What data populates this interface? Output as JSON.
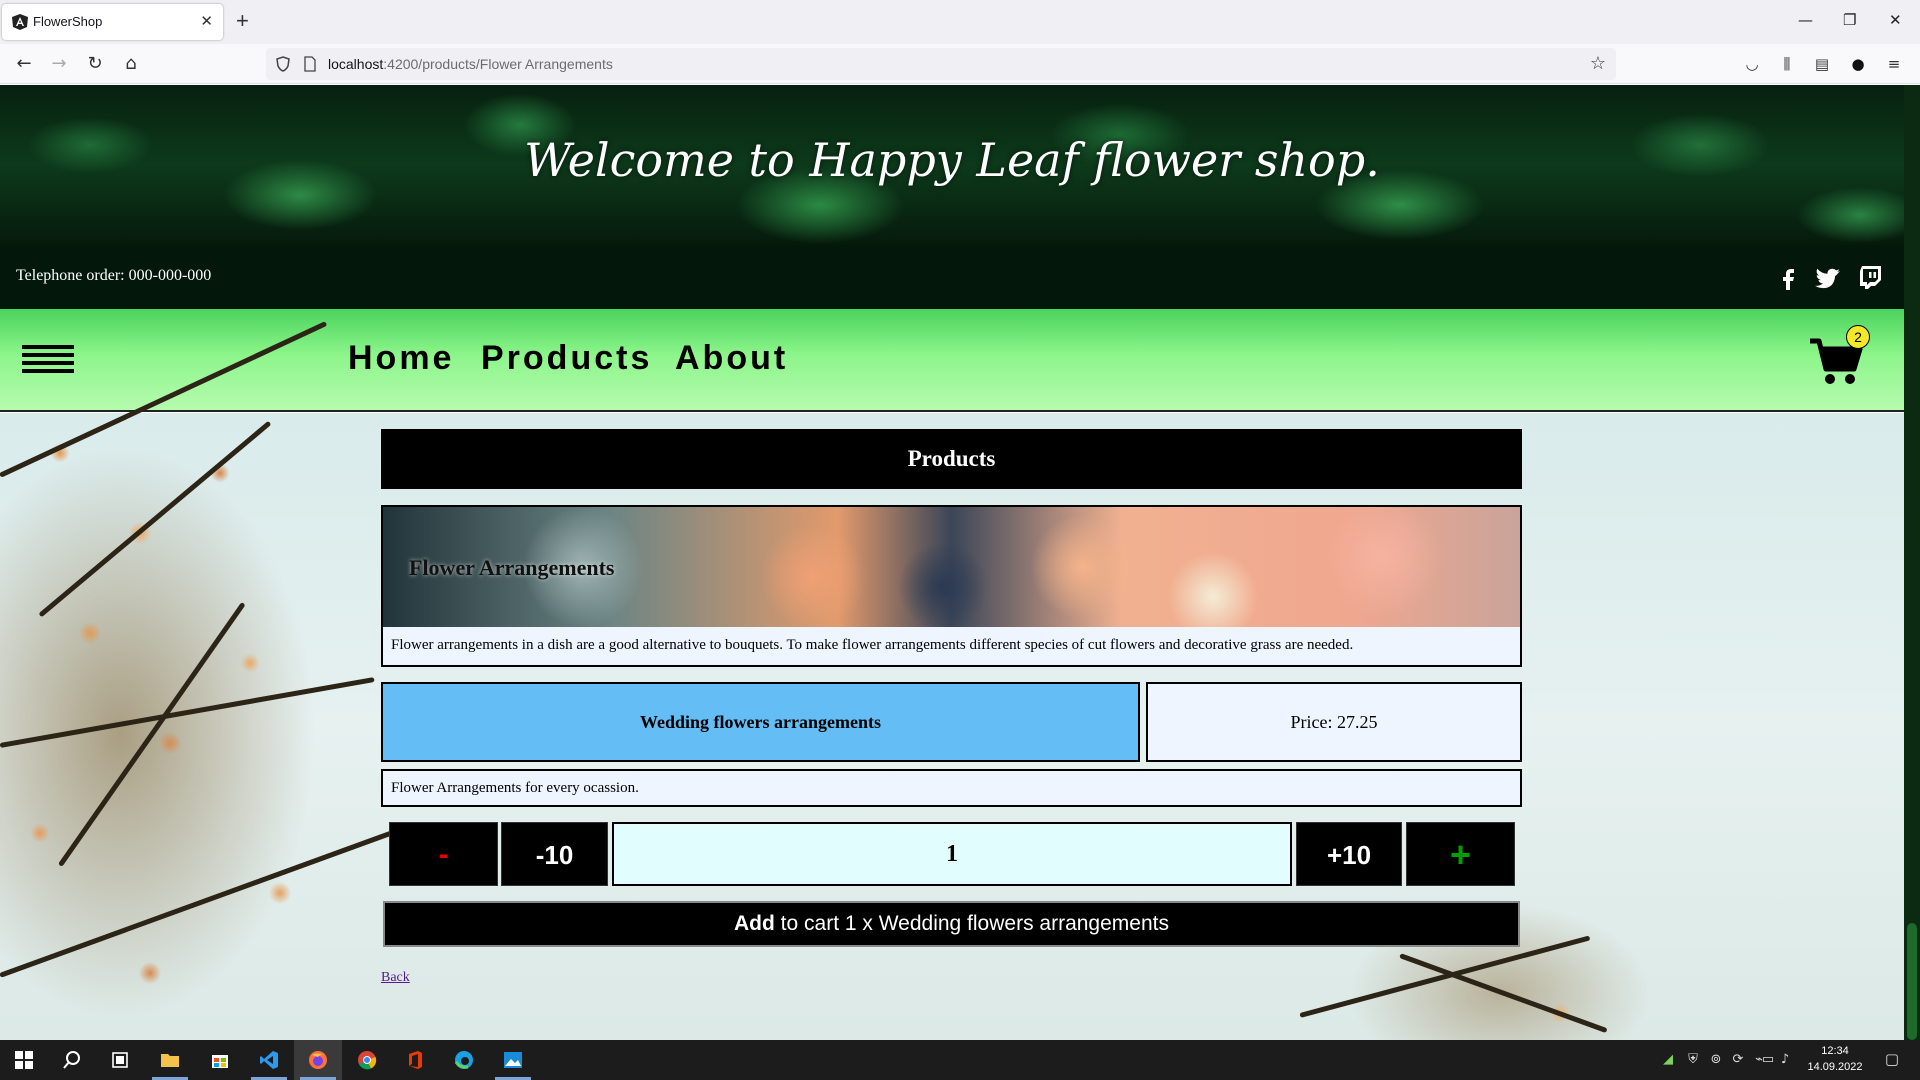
{
  "browser": {
    "tab_title": "FlowerShop",
    "tab_close": "✕",
    "new_tab": "+",
    "url_host": "localhost",
    "url_rest": ":4200/products/Flower Arrangements",
    "window_controls": {
      "minimize": "—",
      "restore": "❐",
      "close": "✕"
    }
  },
  "hero": {
    "title": "Welcome to Happy Leaf flower shop."
  },
  "info": {
    "phone": "Telephone order: 000-000-000"
  },
  "nav": {
    "items": [
      {
        "label": "Home"
      },
      {
        "label": "Products"
      },
      {
        "label": "About"
      }
    ],
    "cart_count": "2"
  },
  "products": {
    "header": "Products",
    "category": {
      "title": "Flower Arrangements",
      "description": "Flower arrangements in a dish are a good alternative to bouquets. To make flower arrangements different species of cut flowers and decorative grass are needed."
    },
    "product": {
      "name": "Wedding flowers arrangements",
      "price": "Price: 27.25",
      "description": "Flower Arrangements for every ocassion."
    },
    "quantity": {
      "minus_label": "-",
      "minus10_label": "-10",
      "value": "1",
      "plus10_label": "+10",
      "plus_label": "+"
    },
    "add_button": {
      "bold": "Add",
      "rest": " to cart 1 x Wedding flowers arrangements"
    },
    "back_link": "Back"
  },
  "taskbar": {
    "time": "12:34",
    "date": "14.09.2022"
  },
  "colors": {
    "nav_gradient_top": "#4bd35e",
    "product_name_bg": "#64bef5",
    "qty_bg": "#e1fdfd",
    "minus_color": "#e00000",
    "plus_color": "#00a000"
  }
}
